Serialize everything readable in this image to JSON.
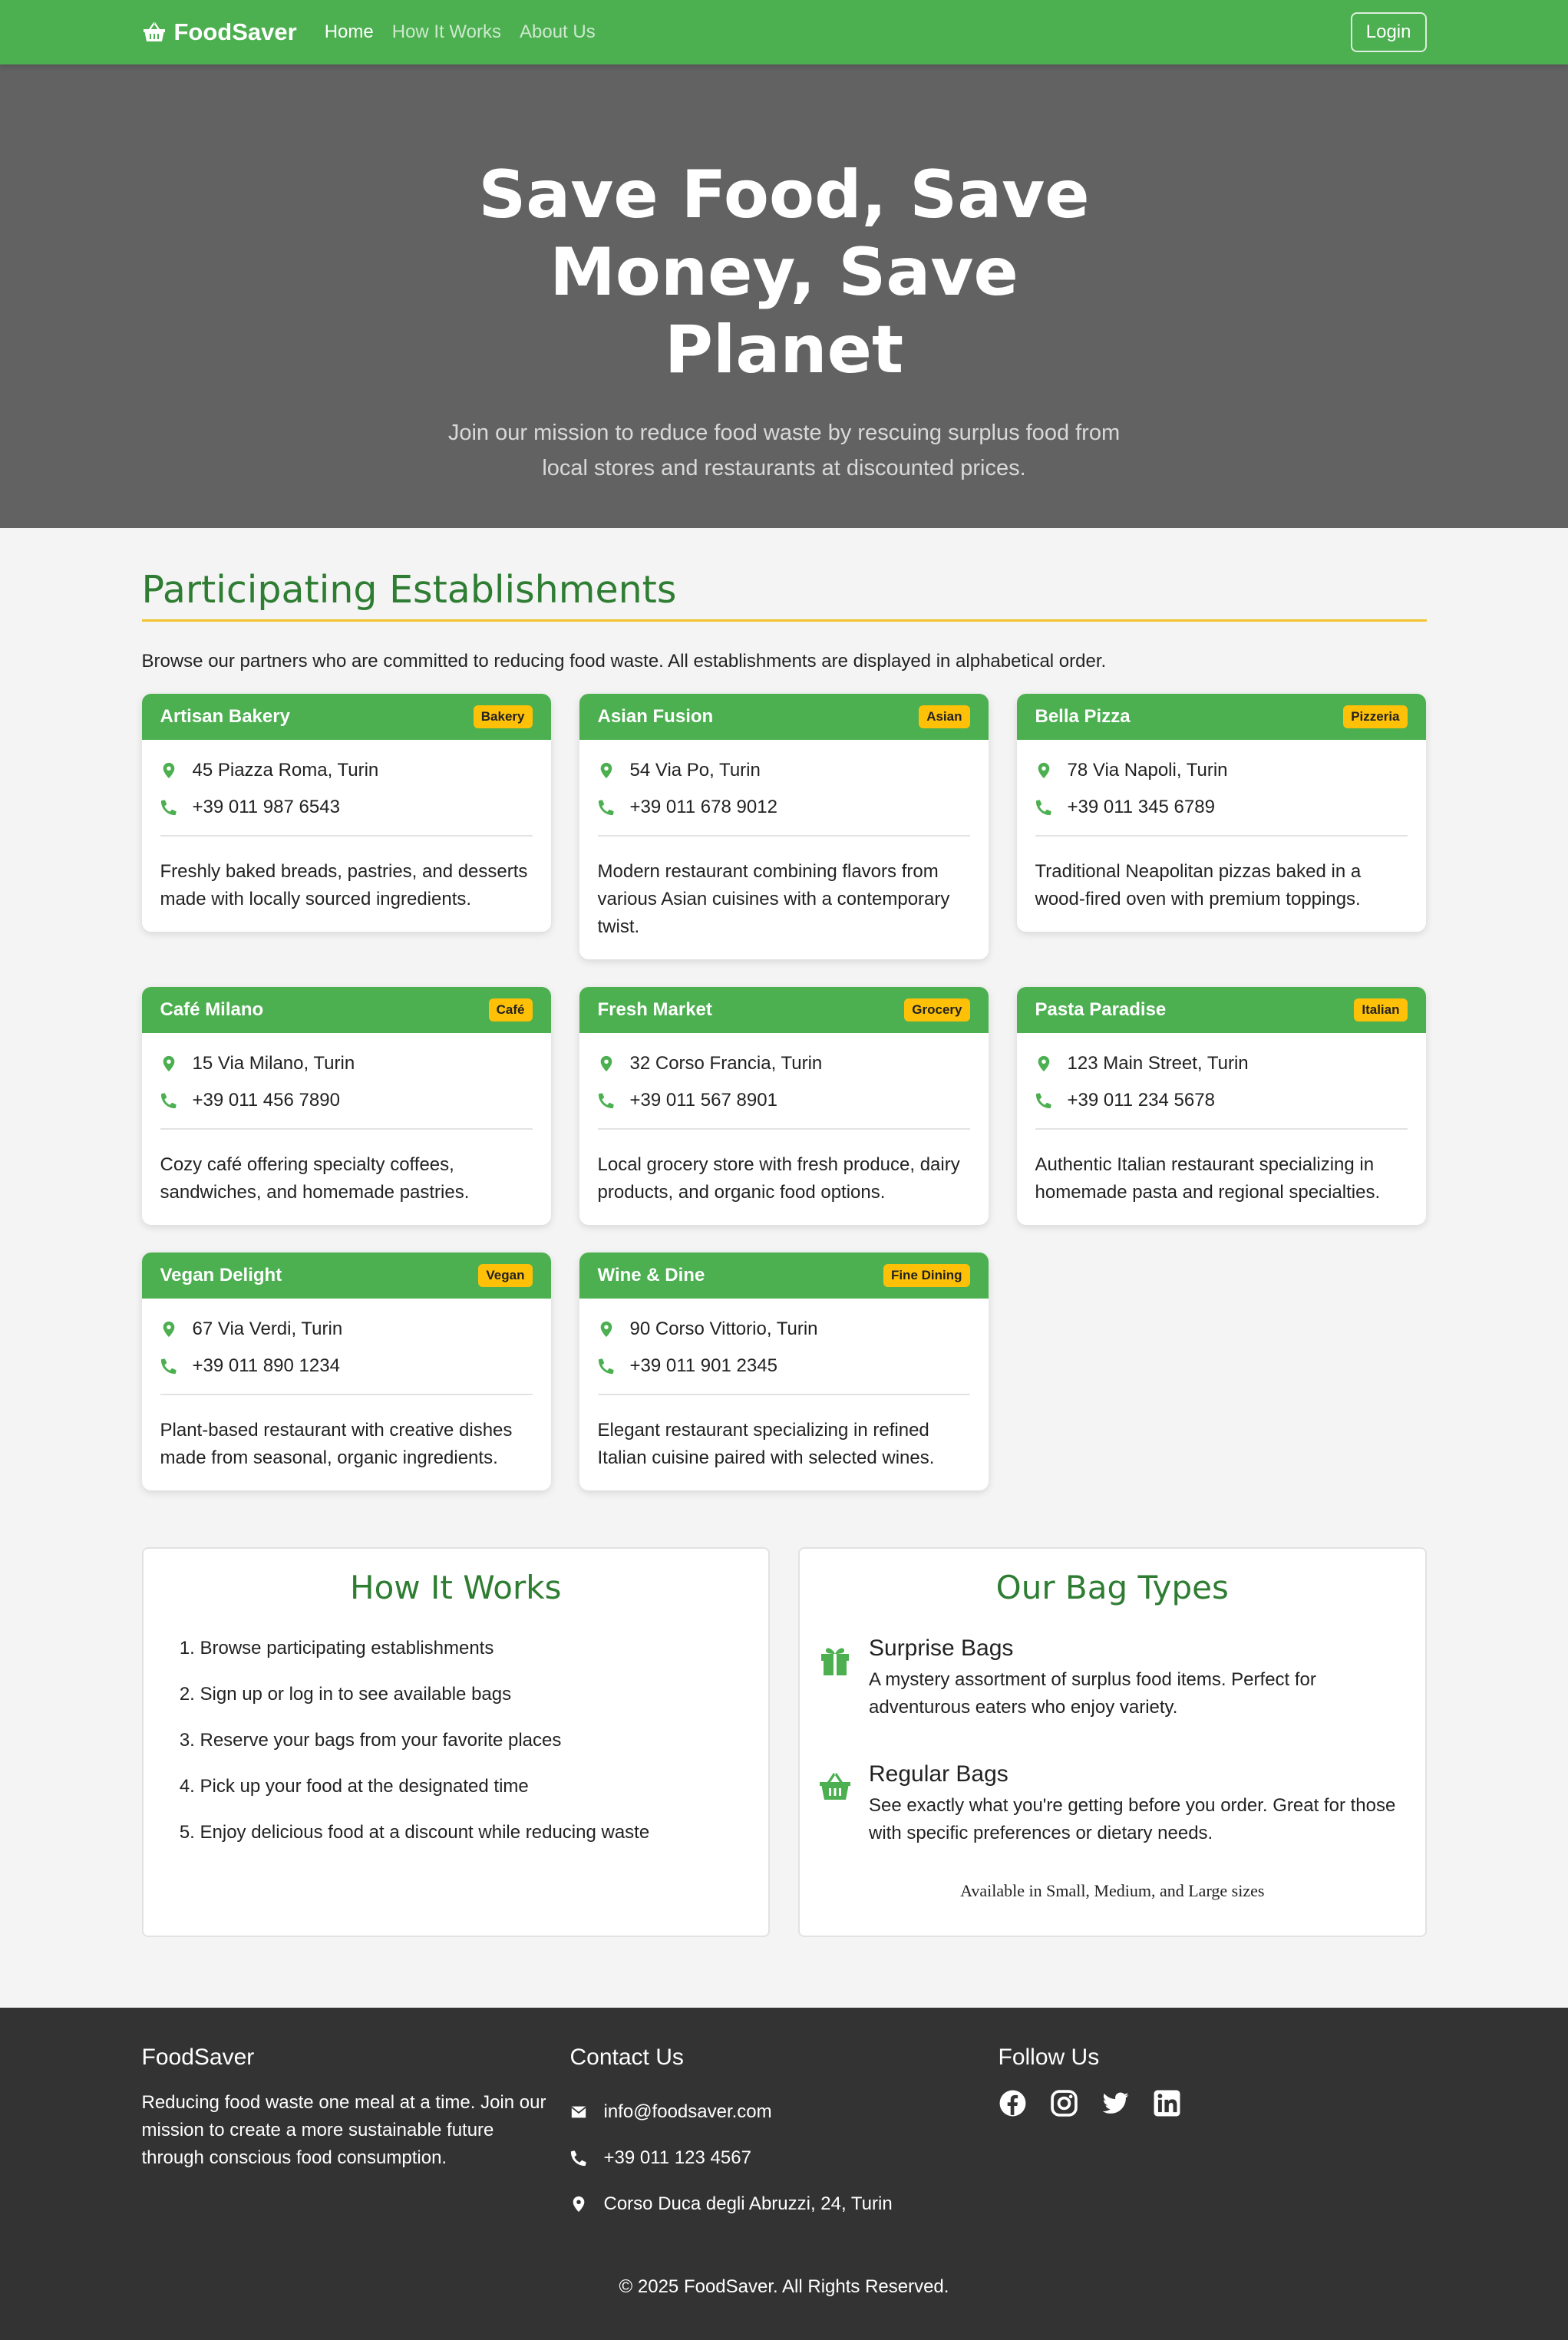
{
  "nav": {
    "brand": "FoodSaver",
    "links": [
      "Home",
      "How It Works",
      "About Us"
    ],
    "login": "Login"
  },
  "hero": {
    "title": "Save Food, Save Money, Save Planet",
    "subtitle": "Join our mission to reduce food waste by rescuing surplus food from local stores and restaurants at discounted prices."
  },
  "establishments": {
    "title": "Participating Establishments",
    "intro": "Browse our partners who are committed to reducing food waste. All establishments are displayed in alphabetical order.",
    "items": [
      {
        "name": "Artisan Bakery",
        "badge": "Bakery",
        "address": "45 Piazza Roma, Turin",
        "phone": "+39 011 987 6543",
        "description": "Freshly baked breads, pastries, and desserts made with locally sourced ingredients."
      },
      {
        "name": "Asian Fusion",
        "badge": "Asian",
        "address": "54 Via Po, Turin",
        "phone": "+39 011 678 9012",
        "description": "Modern restaurant combining flavors from various Asian cuisines with a contemporary twist."
      },
      {
        "name": "Bella Pizza",
        "badge": "Pizzeria",
        "address": "78 Via Napoli, Turin",
        "phone": "+39 011 345 6789",
        "description": "Traditional Neapolitan pizzas baked in a wood-fired oven with premium toppings."
      },
      {
        "name": "Café Milano",
        "badge": "Café",
        "address": "15 Via Milano, Turin",
        "phone": "+39 011 456 7890",
        "description": "Cozy café offering specialty coffees, sandwiches, and homemade pastries."
      },
      {
        "name": "Fresh Market",
        "badge": "Grocery",
        "address": "32 Corso Francia, Turin",
        "phone": "+39 011 567 8901",
        "description": "Local grocery store with fresh produce, dairy products, and organic food options."
      },
      {
        "name": "Pasta Paradise",
        "badge": "Italian",
        "address": "123 Main Street, Turin",
        "phone": "+39 011 234 5678",
        "description": "Authentic Italian restaurant specializing in homemade pasta and regional specialties."
      },
      {
        "name": "Vegan Delight",
        "badge": "Vegan",
        "address": "67 Via Verdi, Turin",
        "phone": "+39 011 890 1234",
        "description": "Plant-based restaurant with creative dishes made from seasonal, organic ingredients."
      },
      {
        "name": "Wine & Dine",
        "badge": "Fine Dining",
        "address": "90 Corso Vittorio, Turin",
        "phone": "+39 011 901 2345",
        "description": "Elegant restaurant specializing in refined Italian cuisine paired with selected wines."
      }
    ]
  },
  "how_it_works": {
    "title": "How It Works",
    "steps": [
      "Browse participating establishments",
      "Sign up or log in to see available bags",
      "Reserve your bags from your favorite places",
      "Pick up your food at the designated time",
      "Enjoy delicious food at a discount while reducing waste"
    ]
  },
  "bag_types": {
    "title": "Our Bag Types",
    "surprise": {
      "title": "Surprise Bags",
      "icon": "gift-icon",
      "text": "A mystery assortment of surplus food items. Perfect for adventurous eaters who enjoy variety."
    },
    "regular": {
      "title": "Regular Bags",
      "icon": "basket-icon",
      "text": "See exactly what you're getting before you order. Great for those with specific preferences or dietary needs."
    },
    "sizes": "Available in Small, Medium, and Large sizes"
  },
  "footer": {
    "about_title": "FoodSaver",
    "about_text": "Reducing food waste one meal at a time. Join our mission to create a more sustainable future through conscious food consumption.",
    "contact_title": "Contact Us",
    "email": "info@foodsaver.com",
    "phone": "+39 011 123 4567",
    "address": "Corso Duca degli Abruzzi, 24, Turin",
    "follow_title": "Follow Us",
    "socials": [
      "facebook-icon",
      "instagram-icon",
      "twitter-icon",
      "linkedin-icon"
    ],
    "copyright": "© 2025 FoodSaver. All Rights Reserved."
  },
  "colors": {
    "primary": "#4caf50",
    "dark_green": "#2e7d32",
    "accent": "#ffc107",
    "hero_bg": "#626262",
    "footer_bg": "#333333"
  }
}
